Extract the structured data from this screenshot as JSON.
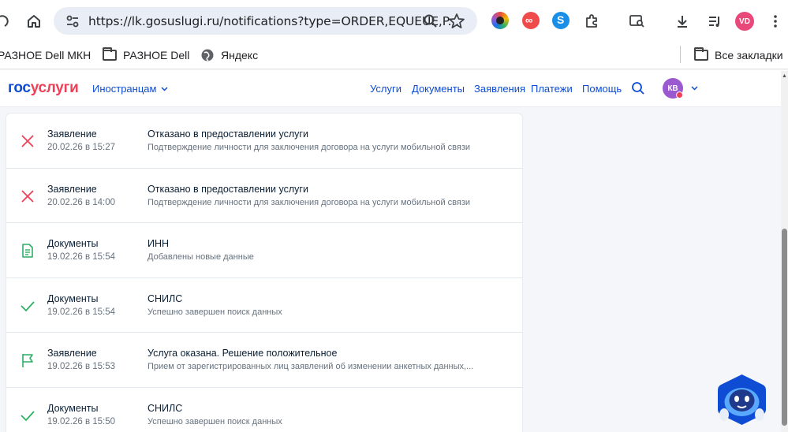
{
  "browser": {
    "url": "https://lk.gosuslugi.ru/notifications?type=ORDER,EQUEUE,P...",
    "profile_initials": "VD",
    "bookmarks": [
      {
        "label": "РАЗНОЕ Dell МКН"
      },
      {
        "label": "РАЗНОЕ Dell"
      },
      {
        "label": "Яндекс"
      }
    ],
    "all_bookmarks_label": "Все закладки"
  },
  "site": {
    "logo_gos": "гос",
    "logo_uslugi": "услуги",
    "lang_label": "Иностранцам",
    "nav": [
      {
        "label": "Услуги"
      },
      {
        "label": "Документы"
      },
      {
        "label": "Заявления"
      },
      {
        "label": "Платежи"
      },
      {
        "label": "Помощь"
      }
    ],
    "user_initials": "КВ"
  },
  "colors": {
    "brand_blue": "#0d4cd3",
    "brand_red": "#ee3f58",
    "success_green": "#2cb163",
    "error_red": "#ee3f58"
  },
  "notifications": [
    {
      "icon": "x-icon",
      "category": "Заявление",
      "date": "20.02.26 в 15:27",
      "title": "Отказано в предоставлении услуги",
      "description": "Подтверждение личности для заключения договора на услуги мобильной связи"
    },
    {
      "icon": "x-icon",
      "category": "Заявление",
      "date": "20.02.26 в 14:00",
      "title": "Отказано в предоставлении услуги",
      "description": "Подтверждение личности для заключения договора на услуги мобильной связи"
    },
    {
      "icon": "document-icon",
      "category": "Документы",
      "date": "19.02.26 в 15:54",
      "title": "ИНН",
      "description": "Добавлены новые данные"
    },
    {
      "icon": "check-icon",
      "category": "Документы",
      "date": "19.02.26 в 15:54",
      "title": "СНИЛС",
      "description": "Успешно завершен поиск данных"
    },
    {
      "icon": "flag-icon",
      "category": "Заявление",
      "date": "19.02.26 в 15:53",
      "title": "Услуга оказана. Решение положительное",
      "description": "Прием от зарегистрированных лиц заявлений об изменении анкетных данных,..."
    },
    {
      "icon": "check-icon",
      "category": "Документы",
      "date": "19.02.26 в 15:50",
      "title": "СНИЛС",
      "description": "Успешно завершен поиск данных"
    }
  ]
}
